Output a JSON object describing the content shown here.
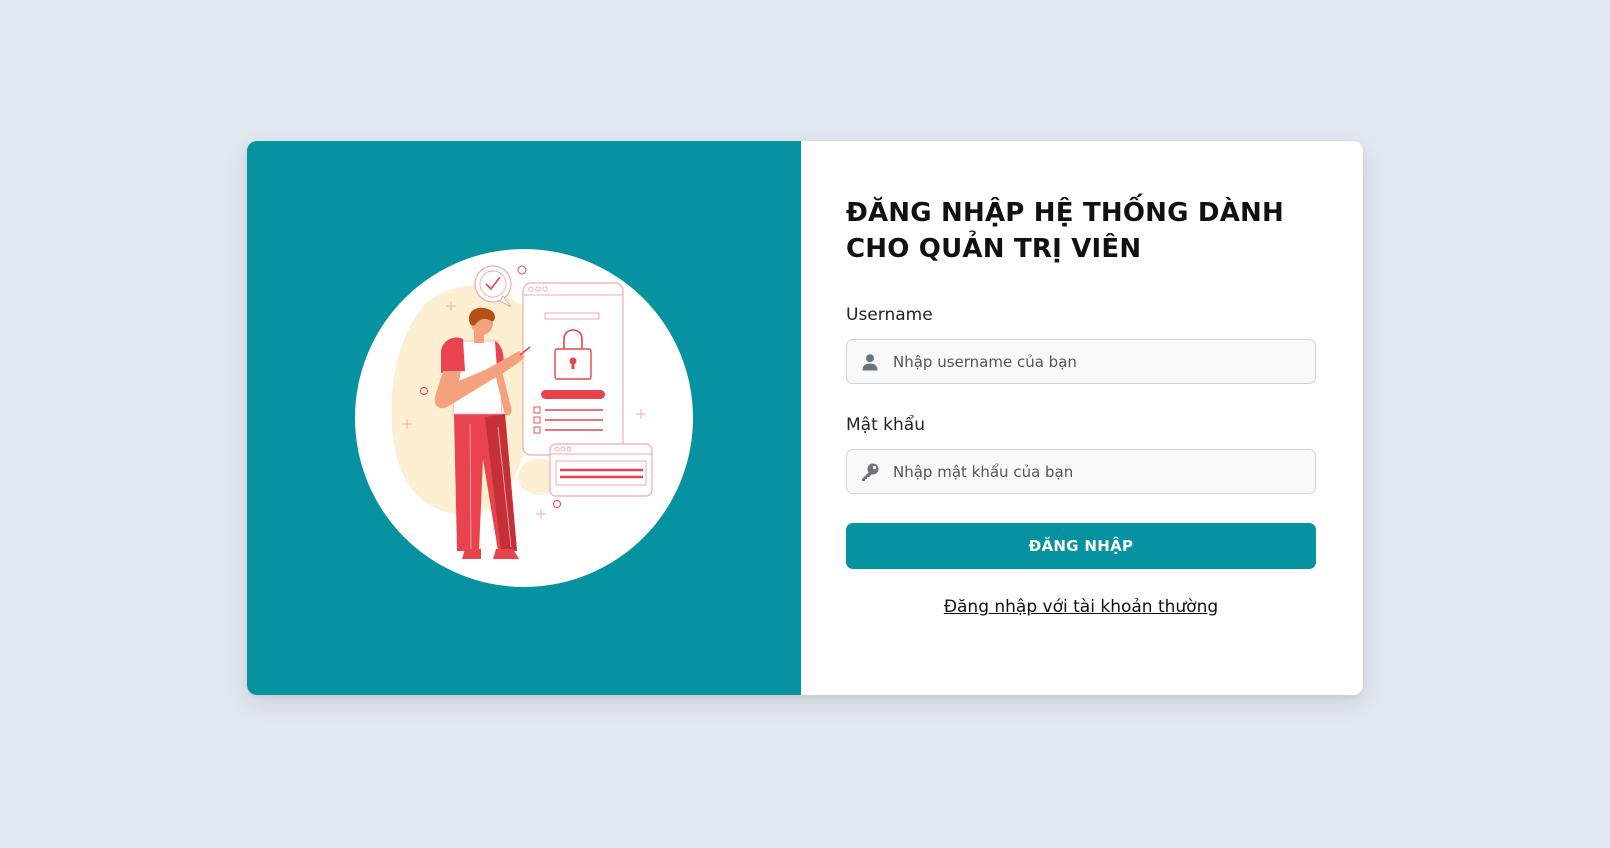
{
  "login": {
    "title": "ĐĂNG NHẬP HỆ THỐNG DÀNH CHO QUẢN TRỊ VIÊN",
    "username": {
      "label": "Username",
      "placeholder": "Nhập username của bạn",
      "value": "",
      "icon": "user-icon"
    },
    "password": {
      "label": "Mật khẩu",
      "placeholder": "Nhập mật khẩu của bạn",
      "value": "",
      "icon": "key-icon"
    },
    "submit_label": "ĐĂNG NHẬP",
    "alt_link": "Đăng nhập với tài khoản thường"
  },
  "illustration": {
    "icon": "security-lock-illustration"
  },
  "colors": {
    "background": "#e2e8f0",
    "brand": "#0692a0",
    "card": "#ffffff",
    "accent_red": "#e8434e"
  }
}
